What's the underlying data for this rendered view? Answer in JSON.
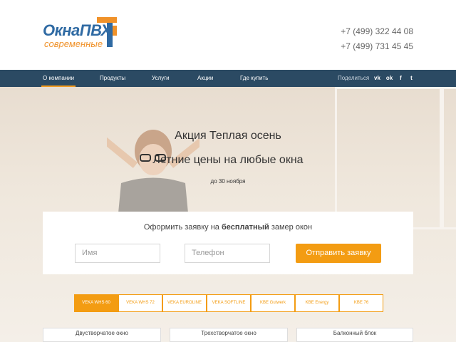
{
  "header": {
    "logo": {
      "title": "ОкнаПВХ",
      "subtitle": "современные"
    },
    "phones": [
      "+7 (499) 322 44 08",
      "+7 (499) 731 45 45"
    ]
  },
  "nav": {
    "items": [
      {
        "label": "О компании",
        "active": true
      },
      {
        "label": "Продукты",
        "active": false
      },
      {
        "label": "Услуги",
        "active": false
      },
      {
        "label": "Акции",
        "active": false
      },
      {
        "label": "Где купить",
        "active": false
      }
    ],
    "share_label": "Поделиться",
    "social": [
      {
        "name": "vk-icon",
        "glyph": "vk"
      },
      {
        "name": "odnoklassniki-icon",
        "glyph": "ok"
      },
      {
        "name": "facebook-icon",
        "glyph": "f"
      },
      {
        "name": "twitter-icon",
        "glyph": "t"
      }
    ]
  },
  "hero": {
    "title": "Акция Теплая осень",
    "subtitle": "Летние цены на любые окна",
    "date": "до 30 ноября"
  },
  "form": {
    "title_before": "Оформить заявку на ",
    "title_bold": "бесплатный",
    "title_after": " замер окон",
    "name_placeholder": "Имя",
    "phone_placeholder": "Телефон",
    "submit_label": "Отправить заявку"
  },
  "tabs": [
    {
      "label": "VEKA WHS 60",
      "active": true
    },
    {
      "label": "VEKA WHS 72",
      "active": false
    },
    {
      "label": "VEKA EUROLINE",
      "active": false
    },
    {
      "label": "VEKA SOFTLINE",
      "active": false
    },
    {
      "label": "KBE Gutwerk",
      "active": false
    },
    {
      "label": "KBE Energy",
      "active": false
    },
    {
      "label": "KBE 76",
      "active": false
    }
  ],
  "products": [
    "Двустворчатое окно",
    "Трехстворчатое окно",
    "Балконный блок"
  ],
  "colors": {
    "accent": "#f39c12",
    "nav_bg": "#2b4a63",
    "brand_blue": "#2f6aa3"
  }
}
